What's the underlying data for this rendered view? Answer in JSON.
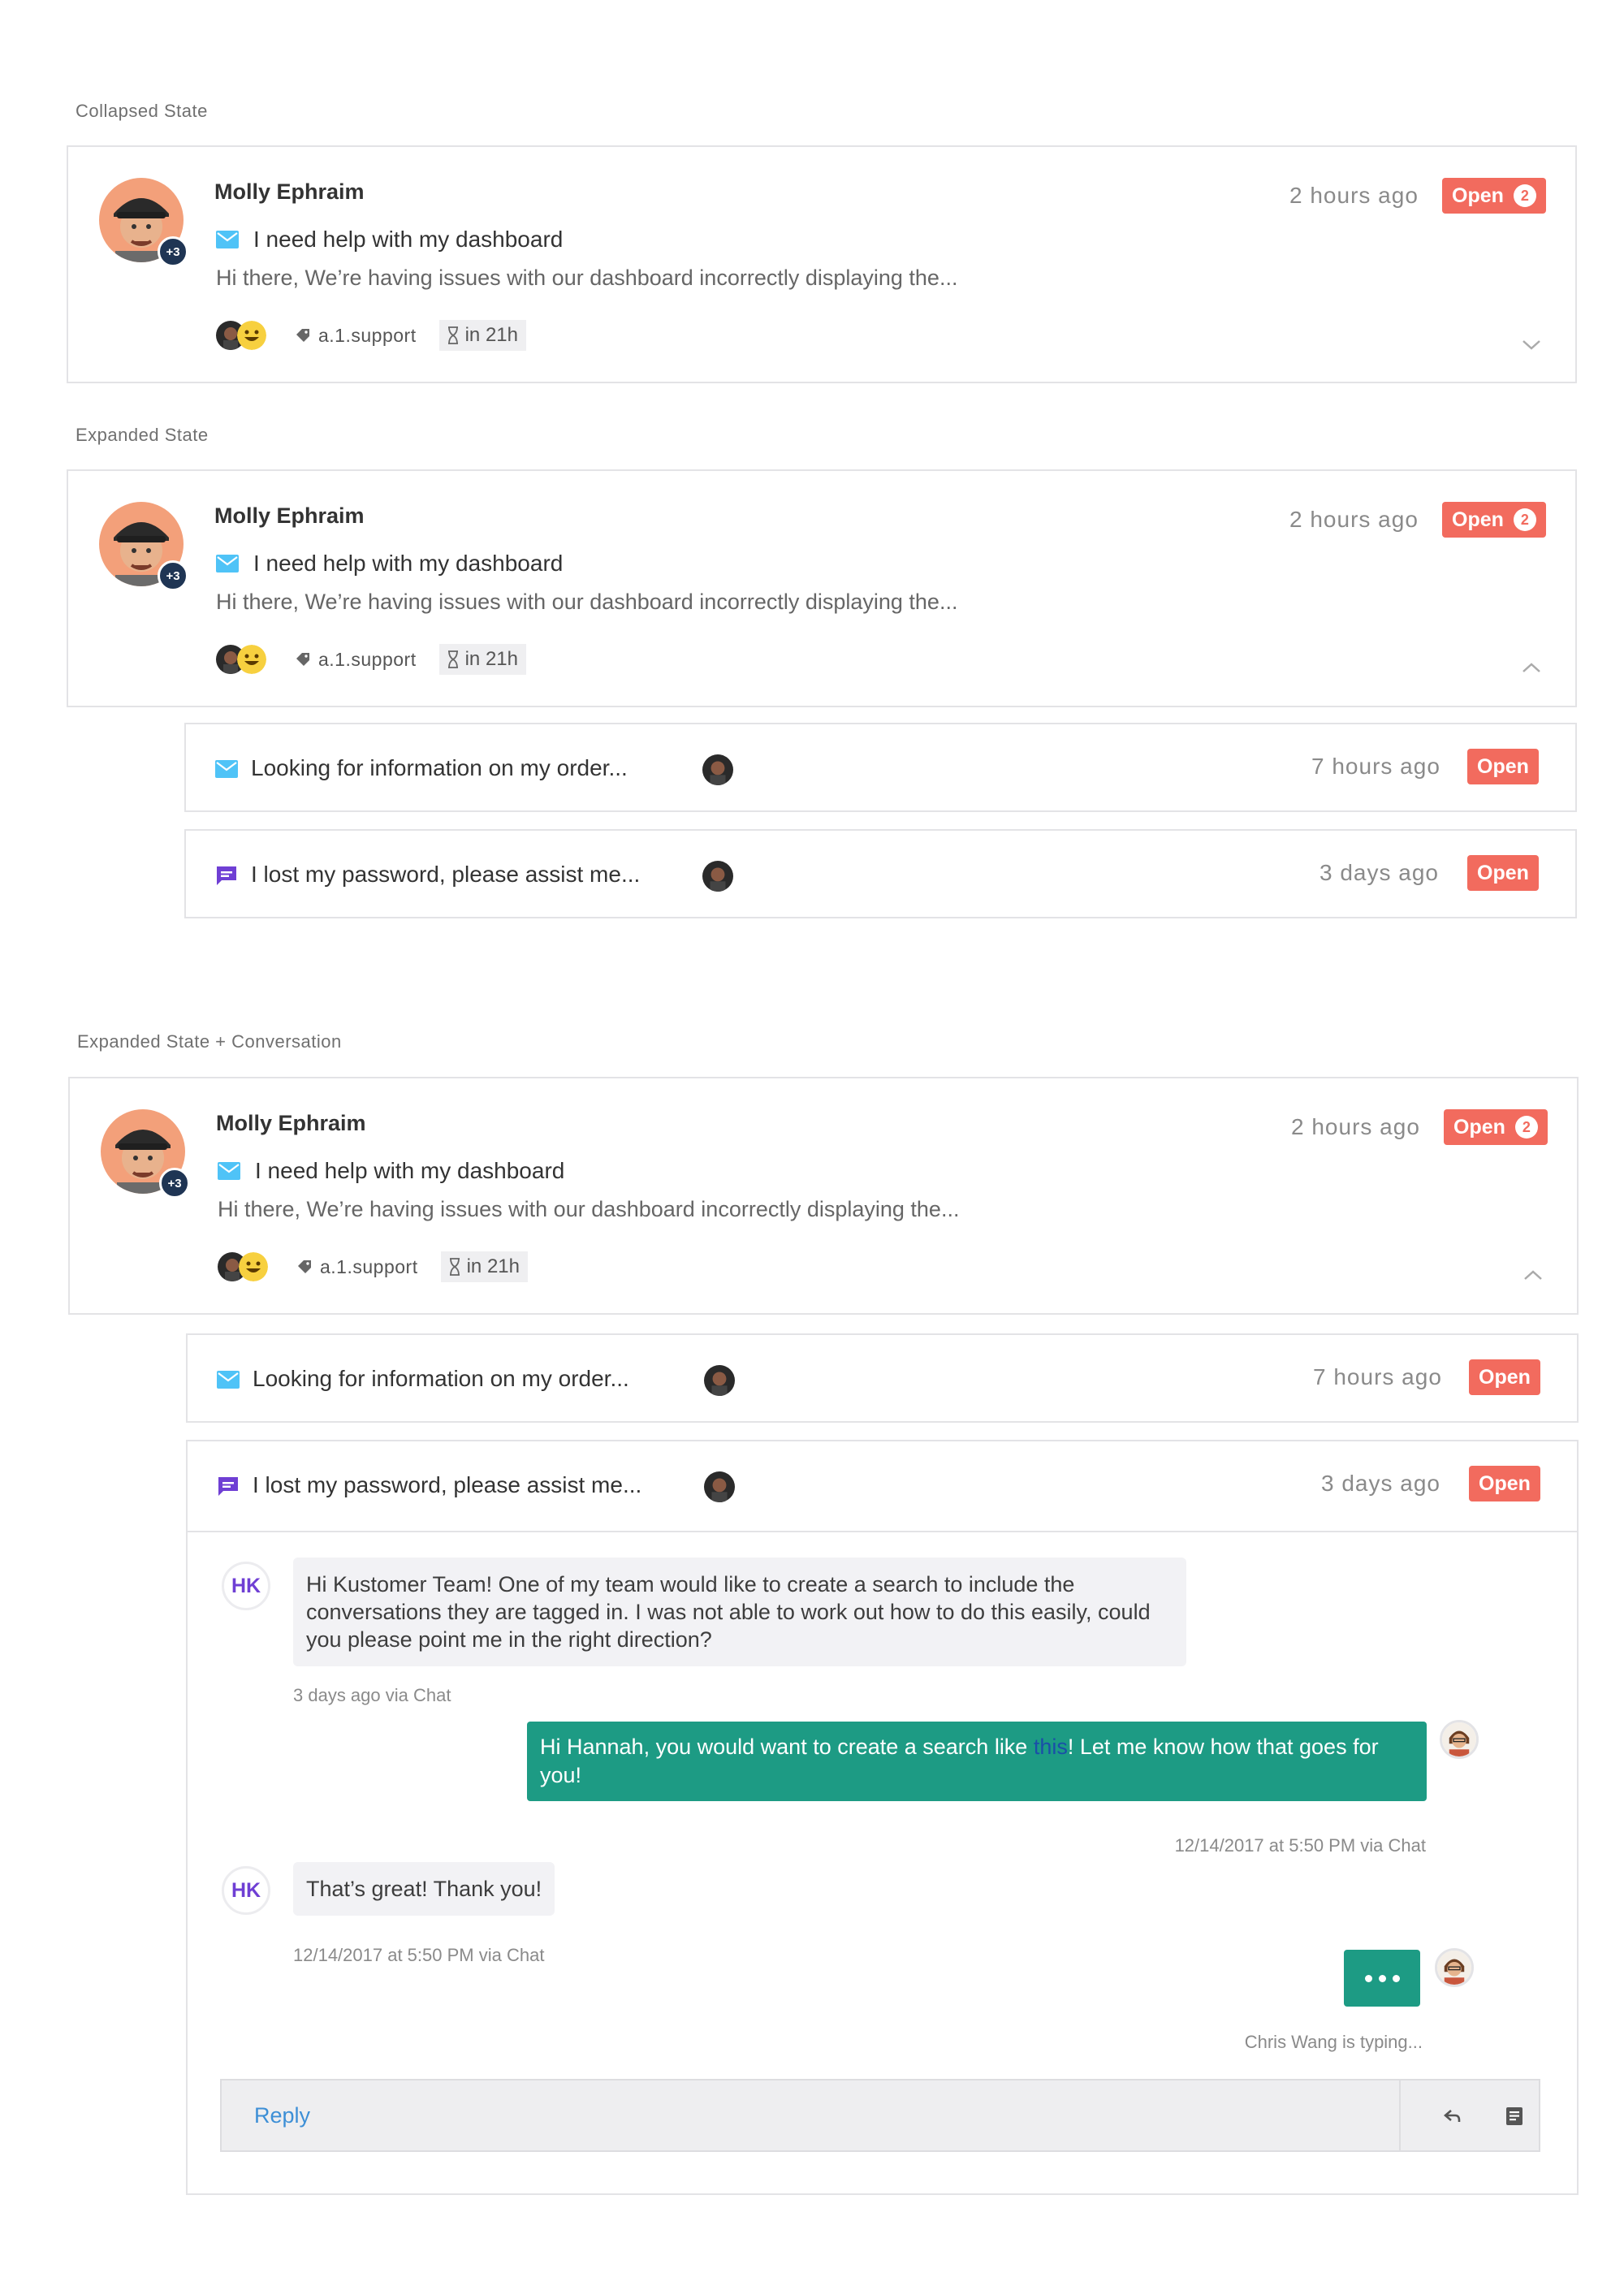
{
  "colors": {
    "open": "#f26b5e",
    "chat_green": "#1d9b84",
    "email_icon": "#4fc3f7",
    "chat_icon": "#6f3fd4",
    "hk_text": "#6f3fd4"
  },
  "labels": {
    "collapsed": "Collapsed State",
    "expanded": "Expanded State",
    "expanded_conv": "Expanded State + Conversation"
  },
  "conversation": {
    "customer_name": "Molly Ephraim",
    "avatar_badge": "+3",
    "subject_icon": "email-icon",
    "subject": "I need help with my dashboard",
    "preview": "Hi there, We’re having issues with our dashboard incorrectly displaying the...",
    "tag_icon": "tag-icon",
    "tag": "a.1.support",
    "sla_icon": "hourglass-icon",
    "sla": "in 21h",
    "time_ago": "2 hours ago",
    "status": "Open",
    "count": "2"
  },
  "sub_conversations": [
    {
      "icon": "email-icon",
      "text": "Looking for information on my order...",
      "time_ago": "7 hours ago",
      "status": "Open"
    },
    {
      "icon": "chat-icon",
      "text": "I lost my password, please assist me...",
      "time_ago": "3 days ago",
      "status": "Open"
    }
  ],
  "messages": {
    "m1": {
      "initials": "HK",
      "text": "Hi Kustomer Team! One of my team would like to create a search to include the conversations they are tagged in. I was not able to work out how to do this easily, could you please point me in the right direction?",
      "meta": "3 days ago via Chat"
    },
    "m2": {
      "text_before": "Hi Hannah, you would want to create a search like ",
      "link": "this",
      "text_after": "! Let me know how that goes for you!",
      "meta": "12/14/2017 at 5:50 PM via Chat"
    },
    "m3": {
      "initials": "HK",
      "text": "That’s great! Thank you!",
      "meta": "12/14/2017 at 5:50 PM via Chat"
    },
    "typing_text": "Chris Wang is typing..."
  },
  "reply": {
    "placeholder": "Reply",
    "reply_icon": "reply-arrow-icon",
    "note_icon": "note-icon"
  }
}
